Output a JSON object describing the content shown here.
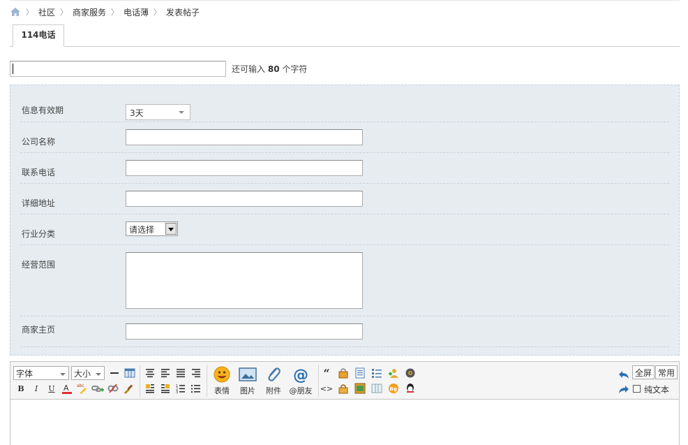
{
  "breadcrumb": {
    "items": [
      "社区",
      "商家服务",
      "电话薄",
      "发表帖子"
    ]
  },
  "tab": {
    "label": "114电话"
  },
  "title_field": {
    "value": "",
    "counter_prefix": "还可输入",
    "counter_value": "80",
    "counter_suffix": "个字符"
  },
  "form": {
    "validity": {
      "label": "信息有效期",
      "value": "3天"
    },
    "company": {
      "label": "公司名称",
      "value": ""
    },
    "phone": {
      "label": "联系电话",
      "value": ""
    },
    "address": {
      "label": "详细地址",
      "value": ""
    },
    "industry": {
      "label": "行业分类",
      "value": "请选择"
    },
    "scope": {
      "label": "经营范围",
      "value": ""
    },
    "homepage": {
      "label": "商家主页",
      "value": ""
    }
  },
  "editor": {
    "font_label": "字体",
    "size_label": "大小",
    "emoji_label": "表情",
    "image_label": "图片",
    "attach_label": "附件",
    "at_label": "@朋友",
    "fullscreen_label": "全屏",
    "common_label": "常用",
    "plaintext_label": "纯文本",
    "plaintext_checked": false
  }
}
